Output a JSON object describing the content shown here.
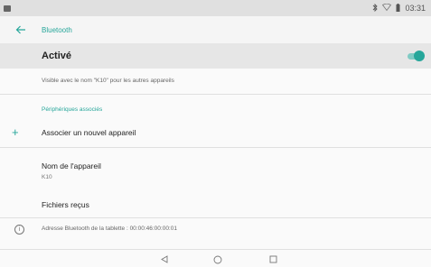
{
  "status_bar": {
    "time": "03:31"
  },
  "app_bar": {
    "title": "Bluetooth"
  },
  "master_switch": {
    "label": "Activé",
    "on": true
  },
  "visibility": {
    "text": "Visible avec le nom \"K10\" pour les autres appareils"
  },
  "paired_section": {
    "header": "Périphériques associés"
  },
  "pair_new": {
    "label": "Associer un nouvel appareil"
  },
  "device_name": {
    "title": "Nom de l'appareil",
    "value": "K10"
  },
  "received_files": {
    "label": "Fichiers reçus"
  },
  "bt_address": {
    "text": "Adresse Bluetooth de la tablette : 00:00:46:00:00:01"
  },
  "icons": {
    "back": "arrow-left-icon",
    "add": "plus-icon",
    "info": "info-icon",
    "bluetooth": "bluetooth-icon",
    "wifi": "wifi-icon",
    "battery": "battery-icon"
  },
  "colors": {
    "accent": "#26a69a",
    "switch_track": "#80cbc4"
  }
}
